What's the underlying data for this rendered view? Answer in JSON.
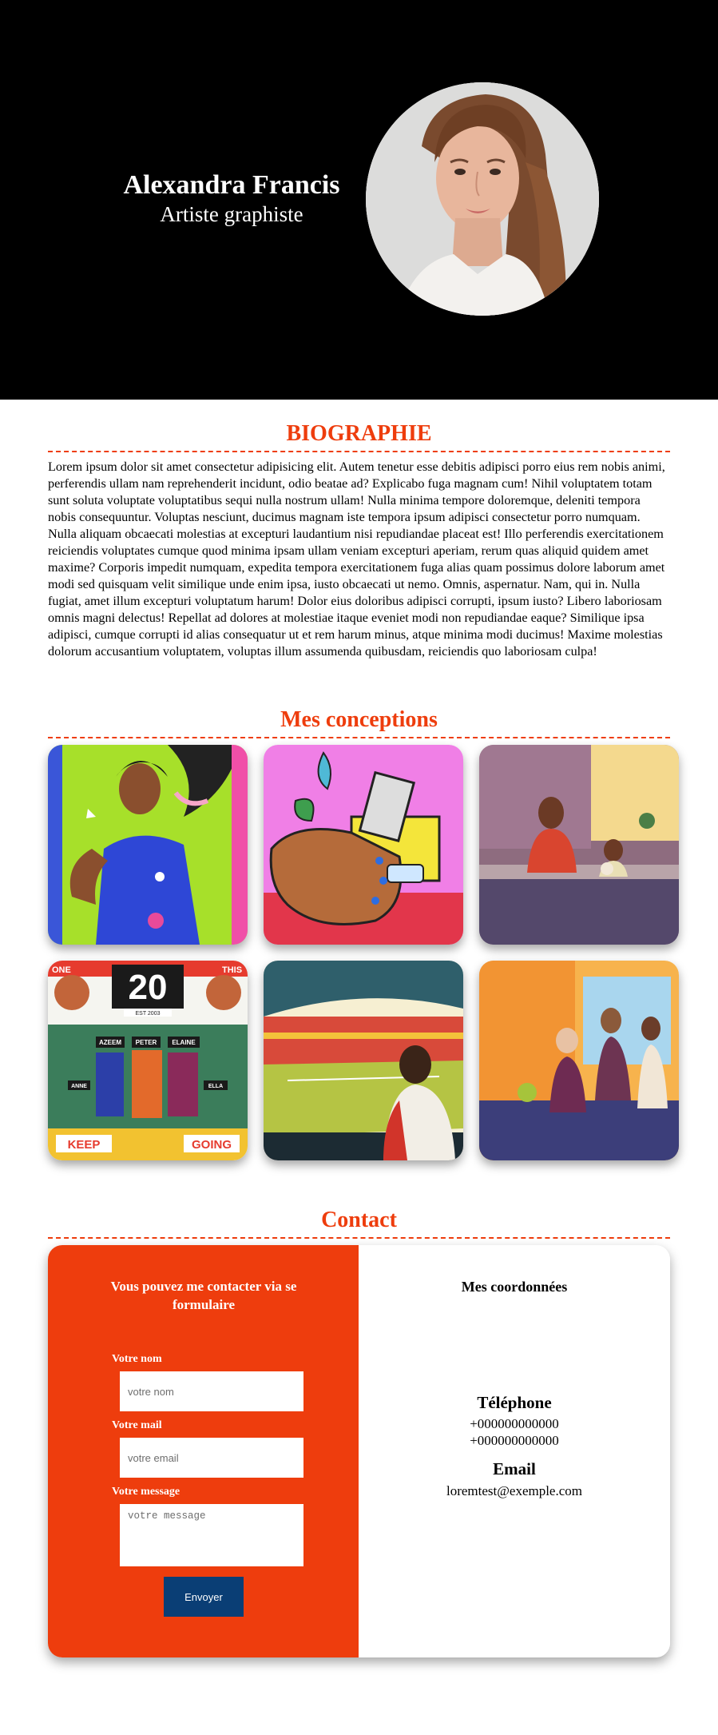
{
  "header": {
    "name": "Alexandra Francis",
    "role": "Artiste graphiste"
  },
  "biography": {
    "title": "BIOGRAPHIE",
    "text": "Lorem ipsum dolor sit amet consectetur adipisicing elit. Autem tenetur esse debitis adipisci porro eius rem nobis animi, perferendis ullam nam reprehenderit incidunt, odio beatae ad? Explicabo fuga magnam cum! Nihil voluptatem totam sunt soluta voluptate voluptatibus sequi nulla nostrum ullam! Nulla minima tempore doloremque, deleniti tempora nobis consequuntur. Voluptas nesciunt, ducimus magnam iste tempora ipsum adipisci consectetur porro numquam. Nulla aliquam obcaecati molestias at excepturi laudantium nisi repudiandae placeat est! Illo perferendis exercitationem reiciendis voluptates cumque quod minima ipsam ullam veniam excepturi aperiam, rerum quas aliquid quidem amet maxime? Corporis impedit numquam, expedita tempora exercitationem fuga alias quam possimus dolore laborum amet modi sed quisquam velit similique unde enim ipsa, iusto obcaecati ut nemo. Omnis, aspernatur. Nam, qui in. Nulla fugiat, amet illum excepturi voluptatum harum! Dolor eius doloribus adipisci corrupti, ipsum iusto? Libero laboriosam omnis magni delectus! Repellat ad dolores at molestiae itaque eveniet modi non repudiandae eaque? Similique ipsa adipisci, cumque corrupti id alias consequatur ut et rem harum minus, atque minima modi ducimus! Maxime molestias dolorum accusantium voluptatem, voluptas illum assumenda quibusdam, reiciendis quo laboriosam culpa!"
  },
  "gallery": {
    "title": "Mes conceptions",
    "items": [
      {
        "icon": "footballer-illustration",
        "text_1": "",
        "text_2": "",
        "text_3": ""
      },
      {
        "icon": "hands-lamp-illustration"
      },
      {
        "icon": "kitchen-illustration"
      },
      {
        "icon": "team-poster-illustration",
        "number": "20",
        "sub": "EST 2003",
        "names": [
          "AZEEM",
          "PETER",
          "ELAINE",
          "ELLA",
          "ANNE"
        ],
        "left_word": "KEEP",
        "right_word": "GOING",
        "top_left": "ONE",
        "top_right": "THIS"
      },
      {
        "icon": "stadium-illustration"
      },
      {
        "icon": "family-kitchen-illustration"
      }
    ]
  },
  "contact": {
    "title": "Contact",
    "form": {
      "heading": "Vous pouvez me contacter via se formulaire",
      "name_label": "Votre nom",
      "name_placeholder": "votre nom",
      "mail_label": "Votre mail",
      "mail_placeholder": "votre email",
      "message_label": "Votre message",
      "message_placeholder": "votre message",
      "submit": "Envoyer"
    },
    "info": {
      "heading": "Mes coordonnées",
      "phone_label": "Téléphone",
      "phones": [
        "+000000000000",
        "+000000000000"
      ],
      "email_label": "Email",
      "email": "loremtest@exemple.com"
    }
  },
  "colors": {
    "accent": "#ee3d0d",
    "button": "#0a3e75",
    "header_bg": "#000000"
  }
}
